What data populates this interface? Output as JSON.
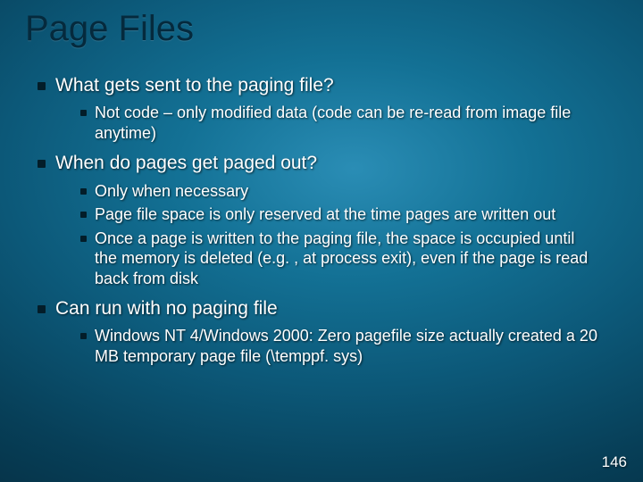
{
  "title": "Page Files",
  "bullets": {
    "b1": {
      "text": "What gets sent to the paging file?",
      "sub": {
        "s1": "Not code – only modified data (code can be re-read from image file anytime)"
      }
    },
    "b2": {
      "text": "When do pages get paged out?",
      "sub": {
        "s1": "Only when necessary",
        "s2": "Page file space is only reserved at the time pages are written out",
        "s3": "Once a page is written to the paging file, the space is occupied until the memory is deleted (e.g. , at process exit), even if the page is read back from disk"
      }
    },
    "b3": {
      "text": "Can run with no paging file",
      "sub": {
        "s1": "Windows NT 4/Windows 2000:  Zero pagefile size actually created a 20 MB temporary page file (\\temppf. sys)"
      }
    }
  },
  "page_number": "146"
}
